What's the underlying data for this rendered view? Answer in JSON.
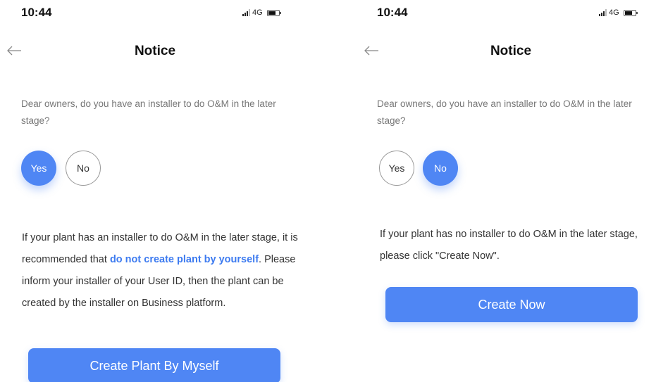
{
  "colors": {
    "accent": "#4f86f4",
    "link": "#3d7bf0",
    "muted_text": "#777777"
  },
  "screens": [
    {
      "status": {
        "time": "10:44",
        "network": "4G"
      },
      "nav": {
        "title": "Notice",
        "back_icon": "arrow-left-icon"
      },
      "question": "Dear owners, do you have an installer to do O&M in the later stage?",
      "choices": {
        "yes": "Yes",
        "no": "No",
        "selected": "yes"
      },
      "info": {
        "part1": "If your plant has an installer to do O&M in the later stage, it is recommended that ",
        "link": "do not create plant by yourself",
        "part2": ". Please inform your installer of your User ID, then the plant can be created by the installer on Business platform."
      },
      "button": "Create Plant By Myself"
    },
    {
      "status": {
        "time": "10:44",
        "network": "4G"
      },
      "nav": {
        "title": "Notice",
        "back_icon": "arrow-left-icon"
      },
      "question": "Dear owners, do you have an installer to do O&M in the later stage?",
      "choices": {
        "yes": "Yes",
        "no": "No",
        "selected": "no"
      },
      "info": {
        "text": "If your plant has no installer to do O&M in the later stage, please click \"Create Now\"."
      },
      "button": "Create Now"
    }
  ]
}
